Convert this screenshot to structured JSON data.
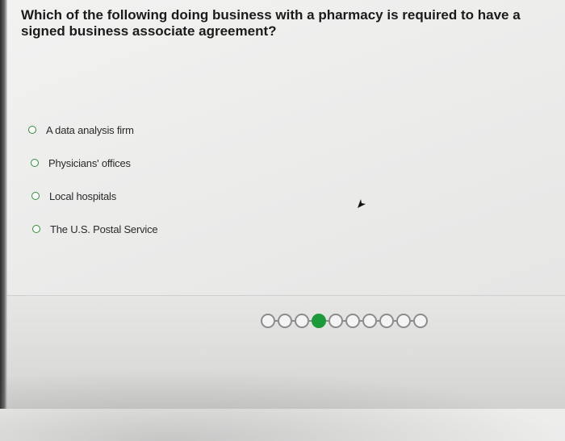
{
  "question": {
    "text": "Which of the following doing business with a pharmacy is required to have a signed business associate agreement?"
  },
  "options": [
    {
      "label": "A data analysis firm",
      "selected": false
    },
    {
      "label": "Physicians' offices",
      "selected": false
    },
    {
      "label": "Local hospitals",
      "selected": false
    },
    {
      "label": "The U.S. Postal Service",
      "selected": false
    }
  ],
  "pagination": {
    "total": 10,
    "current": 4
  },
  "colors": {
    "accent": "#1d9a3a",
    "radio_border": "#2e8f3a",
    "inactive_dot": "#8c8c8c"
  },
  "icons": {
    "cursor": "mouse-pointer-icon"
  }
}
